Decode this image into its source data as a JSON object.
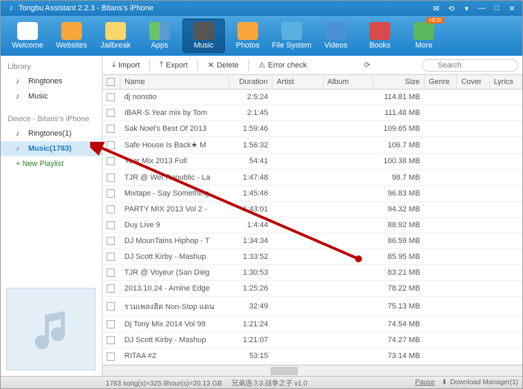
{
  "window": {
    "title": "Tongbu Assistant 2.2.3 - Bitans's iPhone"
  },
  "toolbar": [
    {
      "id": "welcome",
      "label": "Welcome",
      "active": false,
      "iconClass": "home"
    },
    {
      "id": "websites",
      "label": "Websites",
      "active": false,
      "iconClass": "web"
    },
    {
      "id": "jailbreak",
      "label": "Jailbreak",
      "active": false,
      "iconClass": "jail"
    },
    {
      "id": "apps",
      "label": "Apps",
      "active": false,
      "iconClass": "apps"
    },
    {
      "id": "music",
      "label": "Music",
      "active": true,
      "iconClass": "music"
    },
    {
      "id": "photos",
      "label": "Photos",
      "active": false,
      "iconClass": "photo"
    },
    {
      "id": "filesystem",
      "label": "File System",
      "active": false,
      "iconClass": "files"
    },
    {
      "id": "videos",
      "label": "Videos",
      "active": false,
      "iconClass": "video"
    },
    {
      "id": "books",
      "label": "Books",
      "active": false,
      "iconClass": "books"
    },
    {
      "id": "more",
      "label": "More",
      "active": false,
      "iconClass": "more",
      "badge": "NEW"
    }
  ],
  "sidebar": {
    "library_label": "Library",
    "library_items": [
      {
        "id": "lib-ringtones",
        "label": "Ringtones"
      },
      {
        "id": "lib-music",
        "label": "Music"
      }
    ],
    "device_label": "Device - Bitans's iPhone",
    "device_items": [
      {
        "id": "dev-ringtones",
        "label": "Ringtones(1)",
        "selected": false
      },
      {
        "id": "dev-music",
        "label": "Music(1783)",
        "selected": true
      }
    ],
    "new_playlist": "New Playlist"
  },
  "actions": {
    "import": "Import",
    "export": "Export",
    "delete": "Delete",
    "error_check": "Error check",
    "search_placeholder": "Search"
  },
  "columns": {
    "name": "Name",
    "duration": "Duration",
    "artist": "Artist",
    "album": "Album",
    "size": "Size",
    "genre": "Genre",
    "cover": "Cover",
    "lyrics": "Lyrics"
  },
  "tracks": [
    {
      "name": "dj nonstio",
      "duration": "2:5:24",
      "size": "114.81 MB"
    },
    {
      "name": "IBAR-S Year mix by Tom",
      "duration": "2:1:45",
      "size": "111.48 MB"
    },
    {
      "name": "Sak Noel's Best Of 2013",
      "duration": "1:59:46",
      "size": "109.65 MB"
    },
    {
      "name": "Safe House Is Back★ M",
      "duration": "1:56:32",
      "size": "106.7 MB"
    },
    {
      "name": "Year Mix 2013 Full",
      "duration": "54:41",
      "size": "100.38 MB"
    },
    {
      "name": "TJR @ Wet Republic - La",
      "duration": "1:47:48",
      "size": "98.7 MB"
    },
    {
      "name": "Mixtape - Say Something",
      "duration": "1:45:46",
      "size": "96.83 MB"
    },
    {
      "name": "PARTY MIX 2013 Vol 2 -",
      "duration": "1:43:01",
      "size": "94.32 MB"
    },
    {
      "name": "Duy Live 9",
      "duration": "1:4:44",
      "size": "88.92 MB"
    },
    {
      "name": "DJ MounTains Hiphop - T",
      "duration": "1:34:34",
      "size": "86.59 MB"
    },
    {
      "name": "DJ Scott Kirby - Mashup",
      "duration": "1:33:52",
      "size": "85.95 MB"
    },
    {
      "name": "TJR @ Voyeur (San Dieg",
      "duration": "1:30:53",
      "size": "83.21 MB"
    },
    {
      "name": "2013.10.24 - Amine Edge",
      "duration": "1:25:26",
      "size": "78.22 MB"
    },
    {
      "name": "รวมเพลงฮิต Non-Stop แดน",
      "duration": "32:49",
      "size": "75.13 MB"
    },
    {
      "name": "Dj Tony Mix 2014 Vol 99",
      "duration": "1:21:24",
      "size": "74.54 MB"
    },
    {
      "name": "DJ Scott Kirby - Mashup",
      "duration": "1:21:07",
      "size": "74.27 MB"
    },
    {
      "name": "RITAA #2",
      "duration": "53:15",
      "size": "73.14 MB"
    }
  ],
  "status": {
    "summary": "1783 song(s)=325.9hour(s)=20.13 GB",
    "extra": "兄弟连③3:战争之子   v1.0",
    "pause": "Pause",
    "download": "Download Manager(1)"
  }
}
